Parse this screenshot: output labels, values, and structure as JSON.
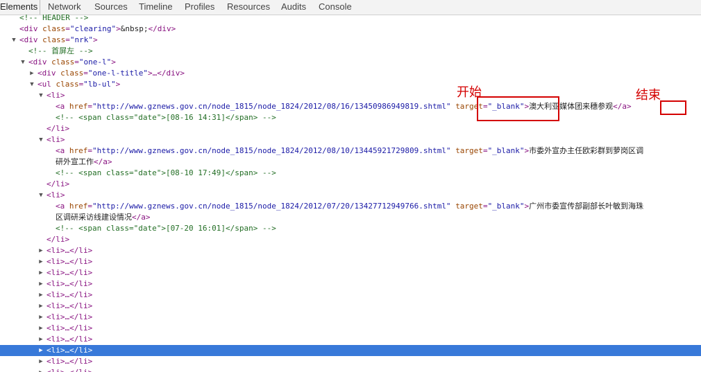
{
  "tabs": [
    "Elements",
    "Network",
    "Sources",
    "Timeline",
    "Profiles",
    "Resources",
    "Audits",
    "Console"
  ],
  "annotations": {
    "start": "开始",
    "end": "结束"
  },
  "nodes": {
    "header_comment": "<!-- HEADER -->",
    "clearing_div": {
      "open": "<div ",
      "attr": "class",
      "val": "\"clearing\"",
      "close1": ">",
      "text": "&nbsp;",
      "close2": "</div>"
    },
    "nrk_div": {
      "open": "<div ",
      "attr": "class",
      "val": "\"nrk\"",
      "close": ">"
    },
    "comment_first": "<!-- 首屏左 -->",
    "one_l_div": {
      "open": "<div ",
      "attr": "class",
      "val": "\"one-l\"",
      "close": ">"
    },
    "one_l_title": {
      "open": "<div ",
      "attr": "class",
      "val": "\"one-l-title\"",
      "close": ">…</div>"
    },
    "lb_ul": {
      "open": "<ul ",
      "attr": "class",
      "val": "\"lb-ul\"",
      "close": ">"
    },
    "li_open": "<li>",
    "li_close": "</li>",
    "li_collapsed": "<li>…</li>",
    "a_open": "<a ",
    "a_close": "</a>",
    "href_attr": "href",
    "target_attr": "target",
    "target_val": "\"_blank\"",
    "eq": "=",
    "gt": ">",
    "items": [
      {
        "href": "\"http://www.gznews.gov.cn/node_1815/node_1824/2012/08/16/13450986949819.shtml\"",
        "text1": "澳大利亚媒体团来穗参观",
        "text2": "",
        "comment": "<!-- <span class=\"date\">[08-16 14:31]</span> -->"
      },
      {
        "href": "\"http://www.gznews.gov.cn/node_1815/node_1824/2012/08/10/13445921729809.shtml\"",
        "text1": "市委外宣办主任欧彩群到萝岗区调",
        "text2": "研外宣工作",
        "comment": "<!-- <span class=\"date\">[08-10 17:49]</span> -->"
      },
      {
        "href": "\"http://www.gznews.gov.cn/node_1815/node_1824/2012/07/20/13427712949766.shtml\"",
        "text1": "广州市委宣传部副部长叶敏到海珠",
        "text2": "区调研采访线建设情况",
        "comment": "<!-- <span class=\"date\">[07-20 16:01]</span> -->"
      }
    ]
  }
}
